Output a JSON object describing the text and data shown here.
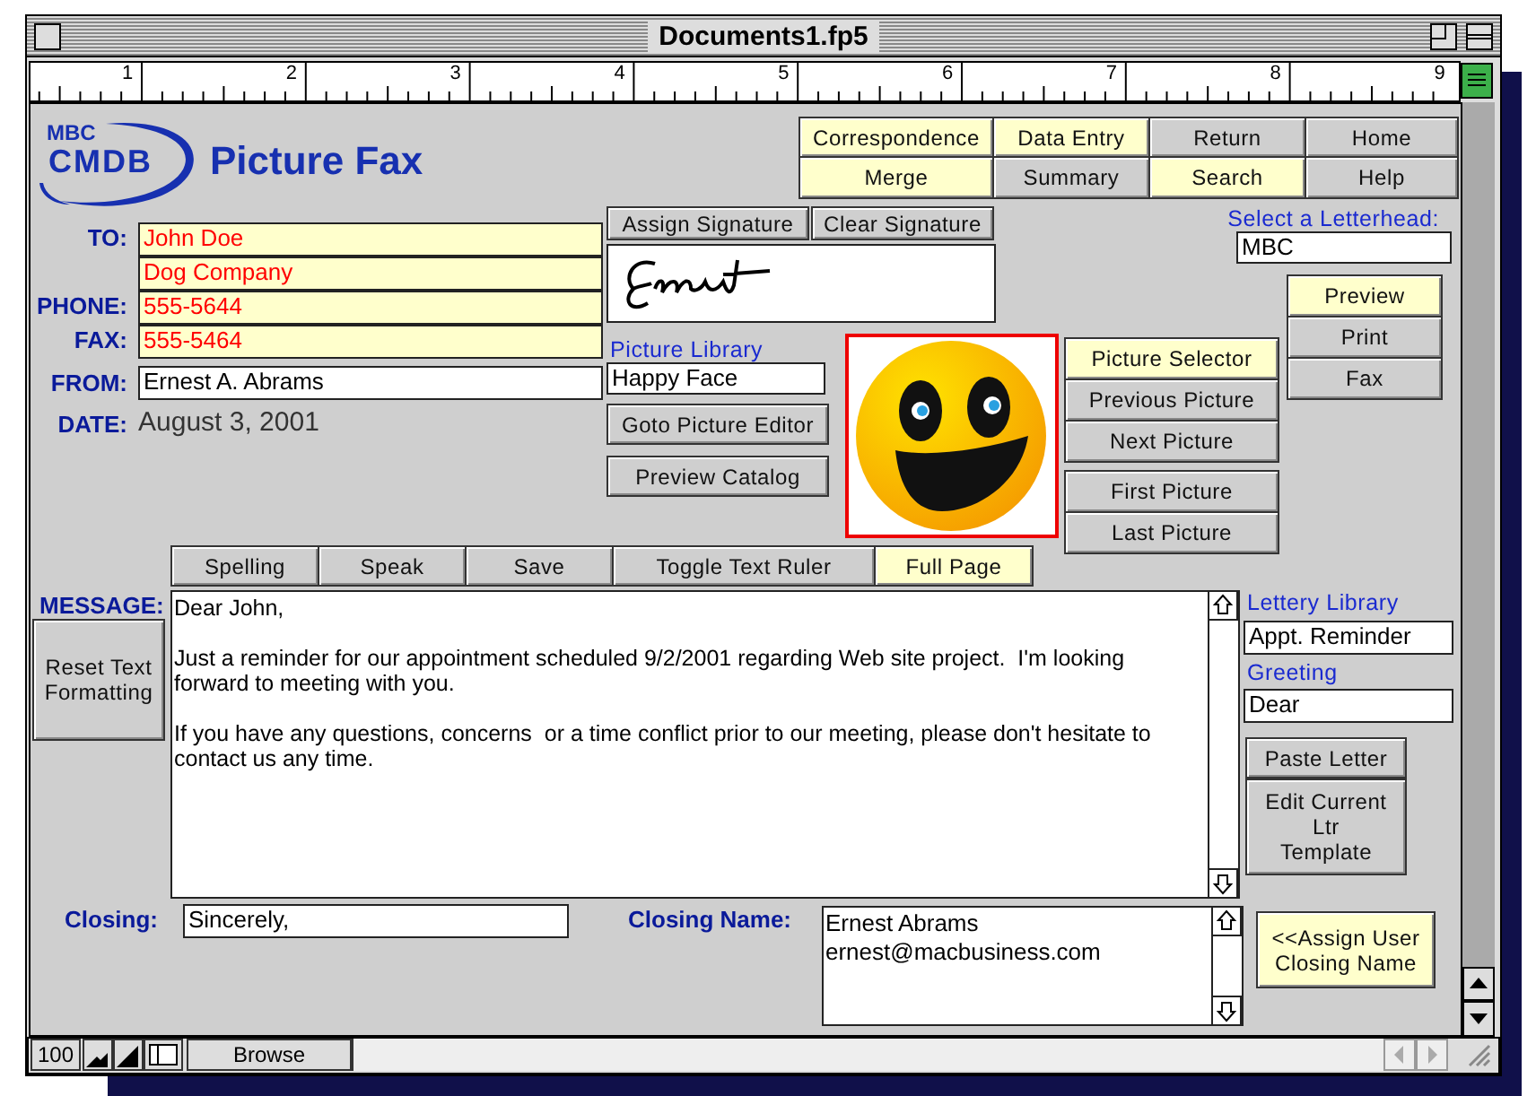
{
  "window": {
    "title": "Documents1.fp5"
  },
  "ruler": [
    "1",
    "2",
    "3",
    "4",
    "5",
    "6",
    "7",
    "8",
    "9"
  ],
  "header": {
    "logo_top": "MBC",
    "logo_main": "CMDB",
    "title": "Picture Fax"
  },
  "nav_buttons": [
    {
      "label": "Correspondence",
      "highlighted": true
    },
    {
      "label": "Data Entry",
      "highlighted": true
    },
    {
      "label": "Return",
      "highlighted": false
    },
    {
      "label": "Home",
      "highlighted": false
    },
    {
      "label": "Merge",
      "highlighted": true
    },
    {
      "label": "Summary",
      "highlighted": false
    },
    {
      "label": "Search",
      "highlighted": true
    },
    {
      "label": "Help",
      "highlighted": false
    }
  ],
  "recipient": [
    {
      "label": "TO:",
      "value": "John Doe"
    },
    {
      "value": "Dog Company"
    },
    {
      "label": "PHONE:",
      "value": "555-5644"
    },
    {
      "label": "FAX:",
      "value": "555-5464"
    }
  ],
  "from": {
    "label": "FROM:",
    "value": "Ernest A. Abrams"
  },
  "date": {
    "label": "DATE:",
    "value": "August 3, 2001"
  },
  "signature_buttons": [
    "Assign Signature",
    "Clear Signature"
  ],
  "picture_library": {
    "label": "Picture Library",
    "value": "Happy Face"
  },
  "picture_buttons": [
    "Goto Picture Editor",
    "Preview Catalog"
  ],
  "picture_nav": [
    {
      "label": "Picture Selector",
      "highlighted": true
    },
    {
      "label": "Previous Picture",
      "highlighted": false
    },
    {
      "label": "Next Picture",
      "highlighted": false
    },
    {
      "label": "First Picture",
      "highlighted": false
    },
    {
      "label": "Last Picture",
      "highlighted": false
    }
  ],
  "letterhead": {
    "label": "Select a Letterhead:",
    "value": "MBC"
  },
  "output_buttons": [
    {
      "label": "Preview",
      "highlighted": true
    },
    {
      "label": "Print",
      "highlighted": false
    },
    {
      "label": "Fax",
      "highlighted": false
    }
  ],
  "message_toolbar": [
    {
      "label": "Spelling",
      "highlighted": false
    },
    {
      "label": "Speak",
      "highlighted": false
    },
    {
      "label": "Save",
      "highlighted": false
    },
    {
      "label": "Toggle Text Ruler",
      "highlighted": false
    },
    {
      "label": "Full Page",
      "highlighted": true
    }
  ],
  "message": {
    "label": "MESSAGE:",
    "paragraphs": [
      "Dear John,",
      "Just a reminder for our appointment scheduled 9/2/2001 regarding Web site project.  I'm looking forward to meeting with you.",
      "If you have any questions, concerns  or a time conflict prior to our meeting, please don't hesitate to contact us any time."
    ]
  },
  "reset_button": "Reset Text Formatting",
  "letter_library": {
    "label": "Lettery Library",
    "value": "Appt. Reminder"
  },
  "greeting": {
    "label": "Greeting",
    "value": "Dear"
  },
  "letter_buttons": [
    "Paste Letter",
    "Edit Current Ltr Template"
  ],
  "closing": {
    "label": "Closing:",
    "value": "Sincerely,"
  },
  "closing_name": {
    "label": "Closing Name:",
    "lines": [
      "Ernest Abrams",
      "ernest@macbusiness.com"
    ]
  },
  "assign_button": "<<Assign User Closing Name",
  "status_bar": {
    "zoom": "100",
    "mode": "Browse"
  }
}
